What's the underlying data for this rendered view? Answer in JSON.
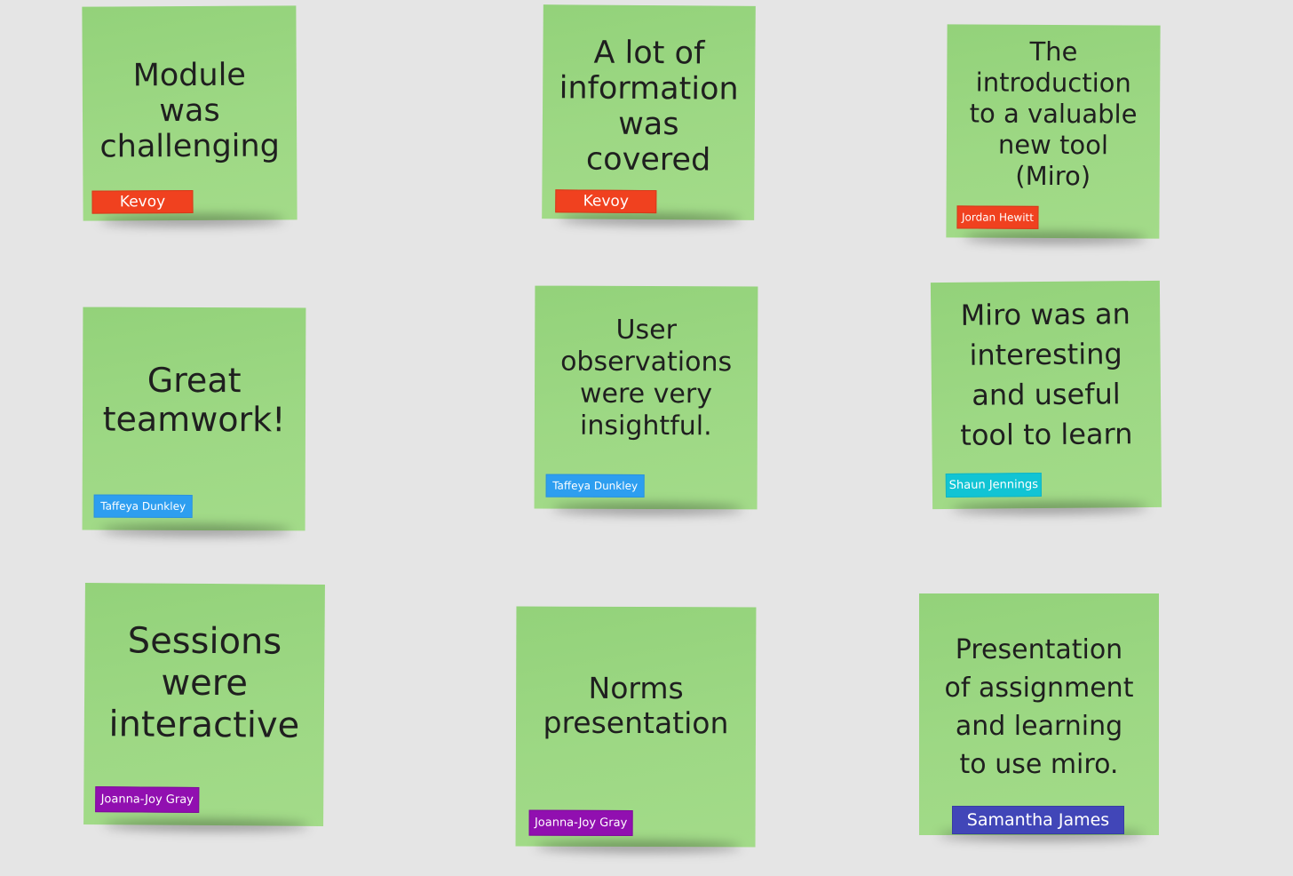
{
  "board": {
    "notes": [
      {
        "text": "Module\nwas\nchallenging",
        "author": "Kevoy",
        "author_color": "#f0411f",
        "note_color": "#9bd882"
      },
      {
        "text": "A lot of\ninformation\nwas\ncovered",
        "author": "Kevoy",
        "author_color": "#f0411f",
        "note_color": "#9bd882"
      },
      {
        "text": "The\nintroduction\nto a valuable\nnew tool\n(Miro)",
        "author": "Jordan Hewitt",
        "author_color": "#f0411f",
        "note_color": "#9bd882"
      },
      {
        "text": "Great\nteamwork!",
        "author": "Taffeya Dunkley",
        "author_color": "#2d9ef0",
        "note_color": "#9bd882"
      },
      {
        "text": "User\nobservations\nwere very\ninsightful.",
        "author": "Taffeya Dunkley",
        "author_color": "#2d9ef0",
        "note_color": "#9bd882"
      },
      {
        "text": "Miro was an\ninteresting\nand useful\ntool to learn",
        "author": "Shaun Jennings",
        "author_color": "#11c4d4",
        "note_color": "#9bd882"
      },
      {
        "text": "Sessions\nwere\ninteractive",
        "author": "Joanna-Joy Gray",
        "author_color": "#910fb0",
        "note_color": "#9bd882"
      },
      {
        "text": "Norms\npresentation",
        "author": "Joanna-Joy Gray",
        "author_color": "#910fb0",
        "note_color": "#9bd882"
      },
      {
        "text": "Presentation\nof assignment\nand learning\nto use miro.",
        "author": "Samantha James",
        "author_color": "#4146b8",
        "note_color": "#9bd882"
      }
    ]
  }
}
